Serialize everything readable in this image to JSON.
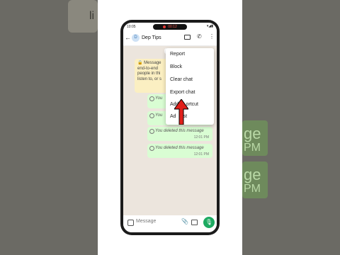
{
  "status_bar": {
    "time": "10:05",
    "recording_time": "00:12",
    "icons": "▾◢▮"
  },
  "header": {
    "back_icon": "←",
    "avatar_letter": "D",
    "contact_name": "Dep Tips",
    "call_icon": "✆",
    "more_icon": "⋮"
  },
  "chat": {
    "date_chip": "T",
    "encryption_notice": [
      "Message",
      "end-to-end",
      "people in thi",
      "listen to, or s",
      "m"
    ],
    "messages": [
      {
        "text": "You",
        "time": ""
      },
      {
        "text": "You",
        "time": ""
      },
      {
        "text": "You deleted this message",
        "time": "12:01 PM"
      },
      {
        "text": "You deleted this message",
        "time": "12:01 PM"
      }
    ]
  },
  "menu": {
    "items": [
      "Report",
      "Block",
      "Clear chat",
      "Export chat",
      "Add shortcut",
      "Add to list"
    ],
    "items_visible": [
      "Report",
      "Block",
      "Clear chat",
      "Export chat",
      "Add",
      "Ad",
      "ortcut",
      "st"
    ]
  },
  "input": {
    "placeholder": "Message",
    "clip_icon": "📎",
    "mic_icon": "🎙"
  },
  "background_side": {
    "left_text": "li",
    "right_lines": [
      "ge",
      "PM",
      "ge",
      "PM"
    ]
  },
  "colors": {
    "accent_green": "#1daa61",
    "bubble_green": "#d9fdd3",
    "arrow_red": "#e0201b",
    "recording_red": "#e53935"
  }
}
